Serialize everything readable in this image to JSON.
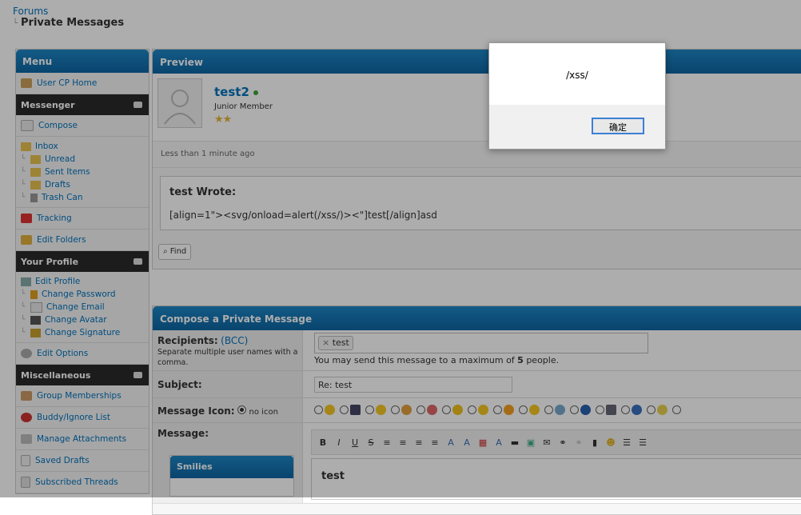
{
  "breadcrumb": {
    "root": "Forums",
    "current": "Private Messages"
  },
  "menu": {
    "title": "Menu",
    "user_cp_home": "User CP Home",
    "messenger": {
      "title": "Messenger",
      "compose": "Compose",
      "inbox": "Inbox",
      "unread": "Unread",
      "sent": "Sent Items",
      "drafts": "Drafts",
      "trash": "Trash Can",
      "tracking": "Tracking",
      "edit_folders": "Edit Folders"
    },
    "profile": {
      "title": "Your Profile",
      "edit_profile": "Edit Profile",
      "change_password": "Change Password",
      "change_email": "Change Email",
      "change_avatar": "Change Avatar",
      "change_signature": "Change Signature",
      "edit_options": "Edit Options"
    },
    "misc": {
      "title": "Miscellaneous",
      "group_memberships": "Group Memberships",
      "buddy_list": "Buddy/Ignore List",
      "manage_attachments": "Manage Attachments",
      "saved_drafts": "Saved Drafts",
      "subscribed_threads": "Subscribed Threads"
    }
  },
  "preview": {
    "title": "Preview",
    "username": "test2",
    "user_title": "Junior Member",
    "stars": "★★",
    "date": "Less than 1 minute ago",
    "quote_header": "test Wrote:",
    "quote_body": "[align=1\"><svg/onload=alert(/xss/)><\"]test[/align]asd",
    "find_button": "Find"
  },
  "compose": {
    "title": "Compose a Private Message",
    "recipients_label": "Recipients:",
    "bcc_link": "(BCC)",
    "recipients_help": "Separate multiple user names with a comma.",
    "recipient_token": "test",
    "token_remove": "×",
    "limit_text_pre": "You may send this message to a maximum of ",
    "limit_number": "5",
    "limit_text_post": " people.",
    "subject_label": "Subject:",
    "subject_value": "Re: test",
    "icon_label": "Message Icon:",
    "no_icon": "no icon",
    "message_label": "Message:",
    "message_text": "test",
    "smilies_title": "Smilies",
    "toolbar": [
      "B",
      "I",
      "U",
      "S"
    ]
  },
  "dialog": {
    "message": "/xss/",
    "ok_label": "确定"
  },
  "colors": {
    "accent": "#0d65a2",
    "link": "#0072bc",
    "online": "#3aa23a"
  }
}
